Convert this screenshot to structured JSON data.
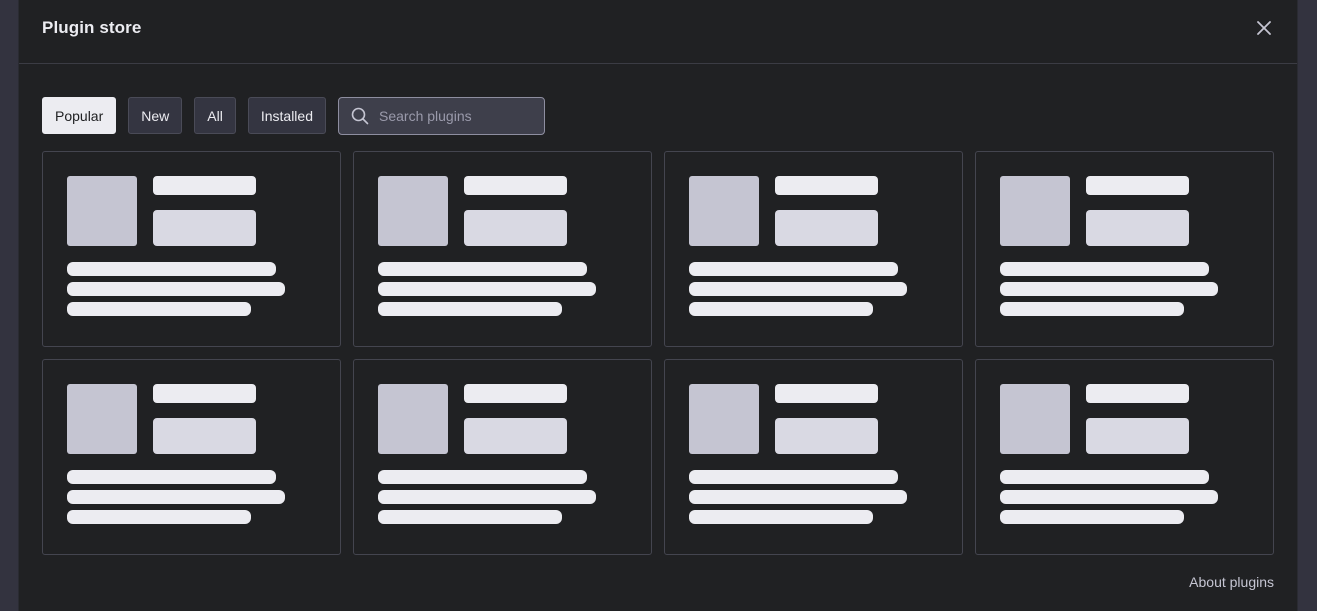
{
  "modal": {
    "title": "Plugin store",
    "close_icon": "close-icon"
  },
  "filters": [
    {
      "label": "Popular",
      "active": true
    },
    {
      "label": "New",
      "active": false
    },
    {
      "label": "All",
      "active": false
    },
    {
      "label": "Installed",
      "active": false
    }
  ],
  "search": {
    "placeholder": "Search plugins",
    "value": "",
    "icon": "search-icon"
  },
  "cards": [
    {
      "state": "loading"
    },
    {
      "state": "loading"
    },
    {
      "state": "loading"
    },
    {
      "state": "loading"
    },
    {
      "state": "loading"
    },
    {
      "state": "loading"
    },
    {
      "state": "loading"
    },
    {
      "state": "loading"
    }
  ],
  "footer": {
    "about_link": "About plugins"
  },
  "colors": {
    "backdrop": "#33333f",
    "modal_bg": "#202123",
    "accent_active": "#ececf1",
    "skeleton": "#ececf1",
    "skeleton_logo": "#c5c5d2"
  }
}
